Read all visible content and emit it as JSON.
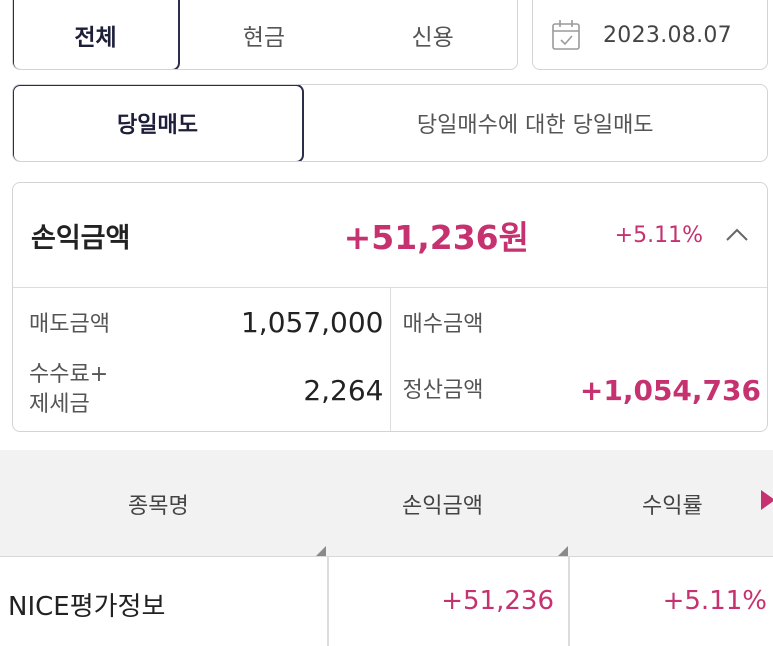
{
  "account_type_tabs": {
    "all": "전체",
    "cash": "현금",
    "credit": "신용",
    "selected": "전체"
  },
  "date": {
    "value": "2023.08.07",
    "icon": "calendar-icon"
  },
  "trade_type_tabs": {
    "same_day_sell": "당일매도",
    "same_day_sell_of_buy": "당일매수에 대한 당일매도",
    "selected": "당일매도"
  },
  "profit_summary": {
    "title": "손익금액",
    "amount": "+51,236원",
    "rate": "+5.11%",
    "toggle_icon": "chevron-up-icon",
    "sell_amount_label": "매도금액",
    "sell_amount": "1,057,000",
    "fee_tax_label_line1": "수수료+",
    "fee_tax_label_line2": "제세금",
    "fee_tax": "2,264",
    "buy_amount_label": "매수금액",
    "buy_amount": "",
    "settlement_label": "정산금액",
    "settlement_amount": "+1,054,736"
  },
  "table": {
    "headers": {
      "name": "종목명",
      "profit": "손익금액",
      "rate": "수익률"
    },
    "rows": [
      {
        "name": "NICE평가정보",
        "profit": "+51,236",
        "rate": "+5.11%"
      }
    ]
  },
  "colors": {
    "accent_pink": "#c6316f",
    "active_border": "#2b2d4a",
    "header_bg": "#f2f2f2"
  }
}
